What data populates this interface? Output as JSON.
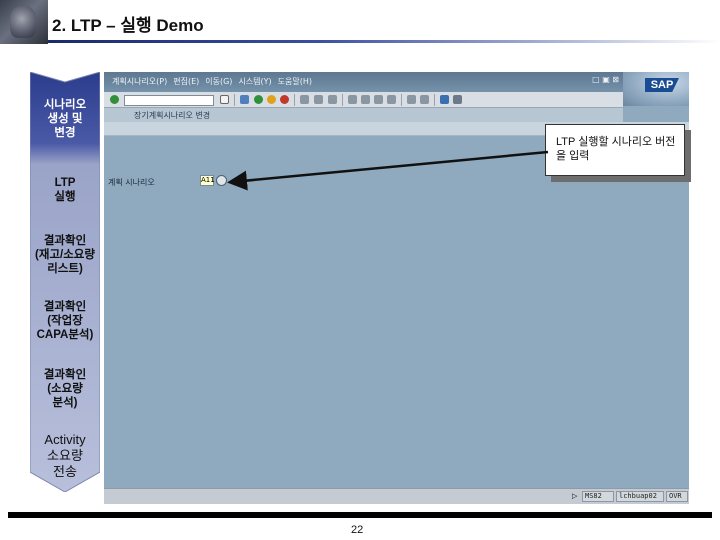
{
  "header": {
    "title": "2. LTP – 실행 Demo"
  },
  "flow": {
    "steps": [
      {
        "label": "시나리오\n생성 및\n변경",
        "active": true
      },
      {
        "label": "LTP\n실행",
        "active": false
      },
      {
        "label": "결과확인\n(재고/소요량\n리스트)",
        "active": false
      },
      {
        "label": "결과확인\n(작업장\nCAPA분석)",
        "active": false
      },
      {
        "label": "결과확인\n(소요량\n분석)",
        "active": false
      },
      {
        "label": "Activity\n소요량\n전송",
        "active": false
      }
    ],
    "colors": {
      "active": "#2b3c8e",
      "inactive": "#9aa4c8"
    }
  },
  "sap": {
    "menu_items": [
      "계획시나리오(P)",
      "편집(E)",
      "이동(G)",
      "시스템(Y)",
      "도움말(H)"
    ],
    "menu_right": "□ ▣ ⊠",
    "logo_text": "SAP",
    "app_title": "장기계획시나리오 변경",
    "field_label": "계획 시나리오",
    "field_value": "A11",
    "status": {
      "system": "MS82",
      "server": "lchbuap02",
      "mode": "OVR"
    }
  },
  "callout": {
    "text": "LTP 실행할 시나리오 버전을 입력"
  },
  "footer": {
    "page_number": "22"
  }
}
